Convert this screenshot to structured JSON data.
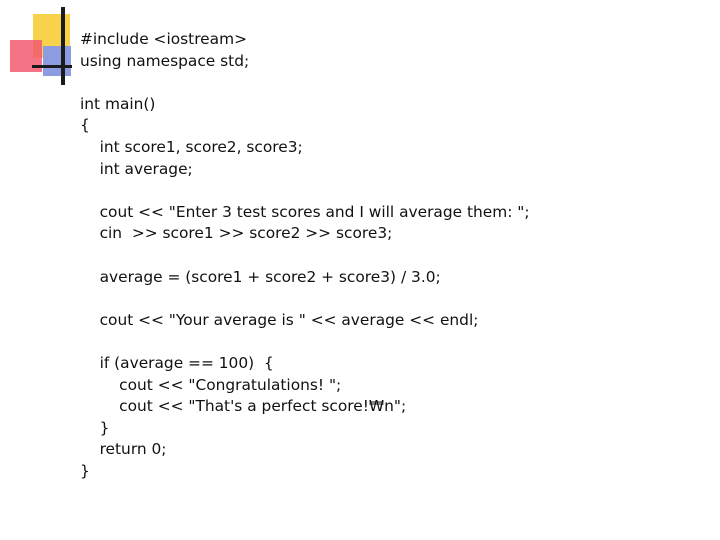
{
  "logo": {
    "icon": "slide-corner-logo",
    "colors": {
      "yellow": "#f8d24a",
      "red": "#f25a6f",
      "blue": "#8d9be0",
      "line": "#1b1b1b"
    }
  },
  "code_lines": [
    "#include <iostream>",
    "using namespace std;",
    "",
    "int main()",
    "{",
    "    int score1, score2, score3;",
    "    int average;",
    "",
    "    cout << \"Enter 3 test scores and I will average them: \";",
    "    cin  >> score1 >> score2 >> score3;",
    "",
    "    average = (score1 + score2 + score3) / 3.0;",
    "",
    "    cout << \"Your average is \" << average << endl;",
    "",
    "    if (average == 100)  {",
    "        cout << \"Congratulations! \";",
    "        cout << \"That's a perfect score!₩n\";",
    "    }",
    "    return 0;",
    "}"
  ]
}
